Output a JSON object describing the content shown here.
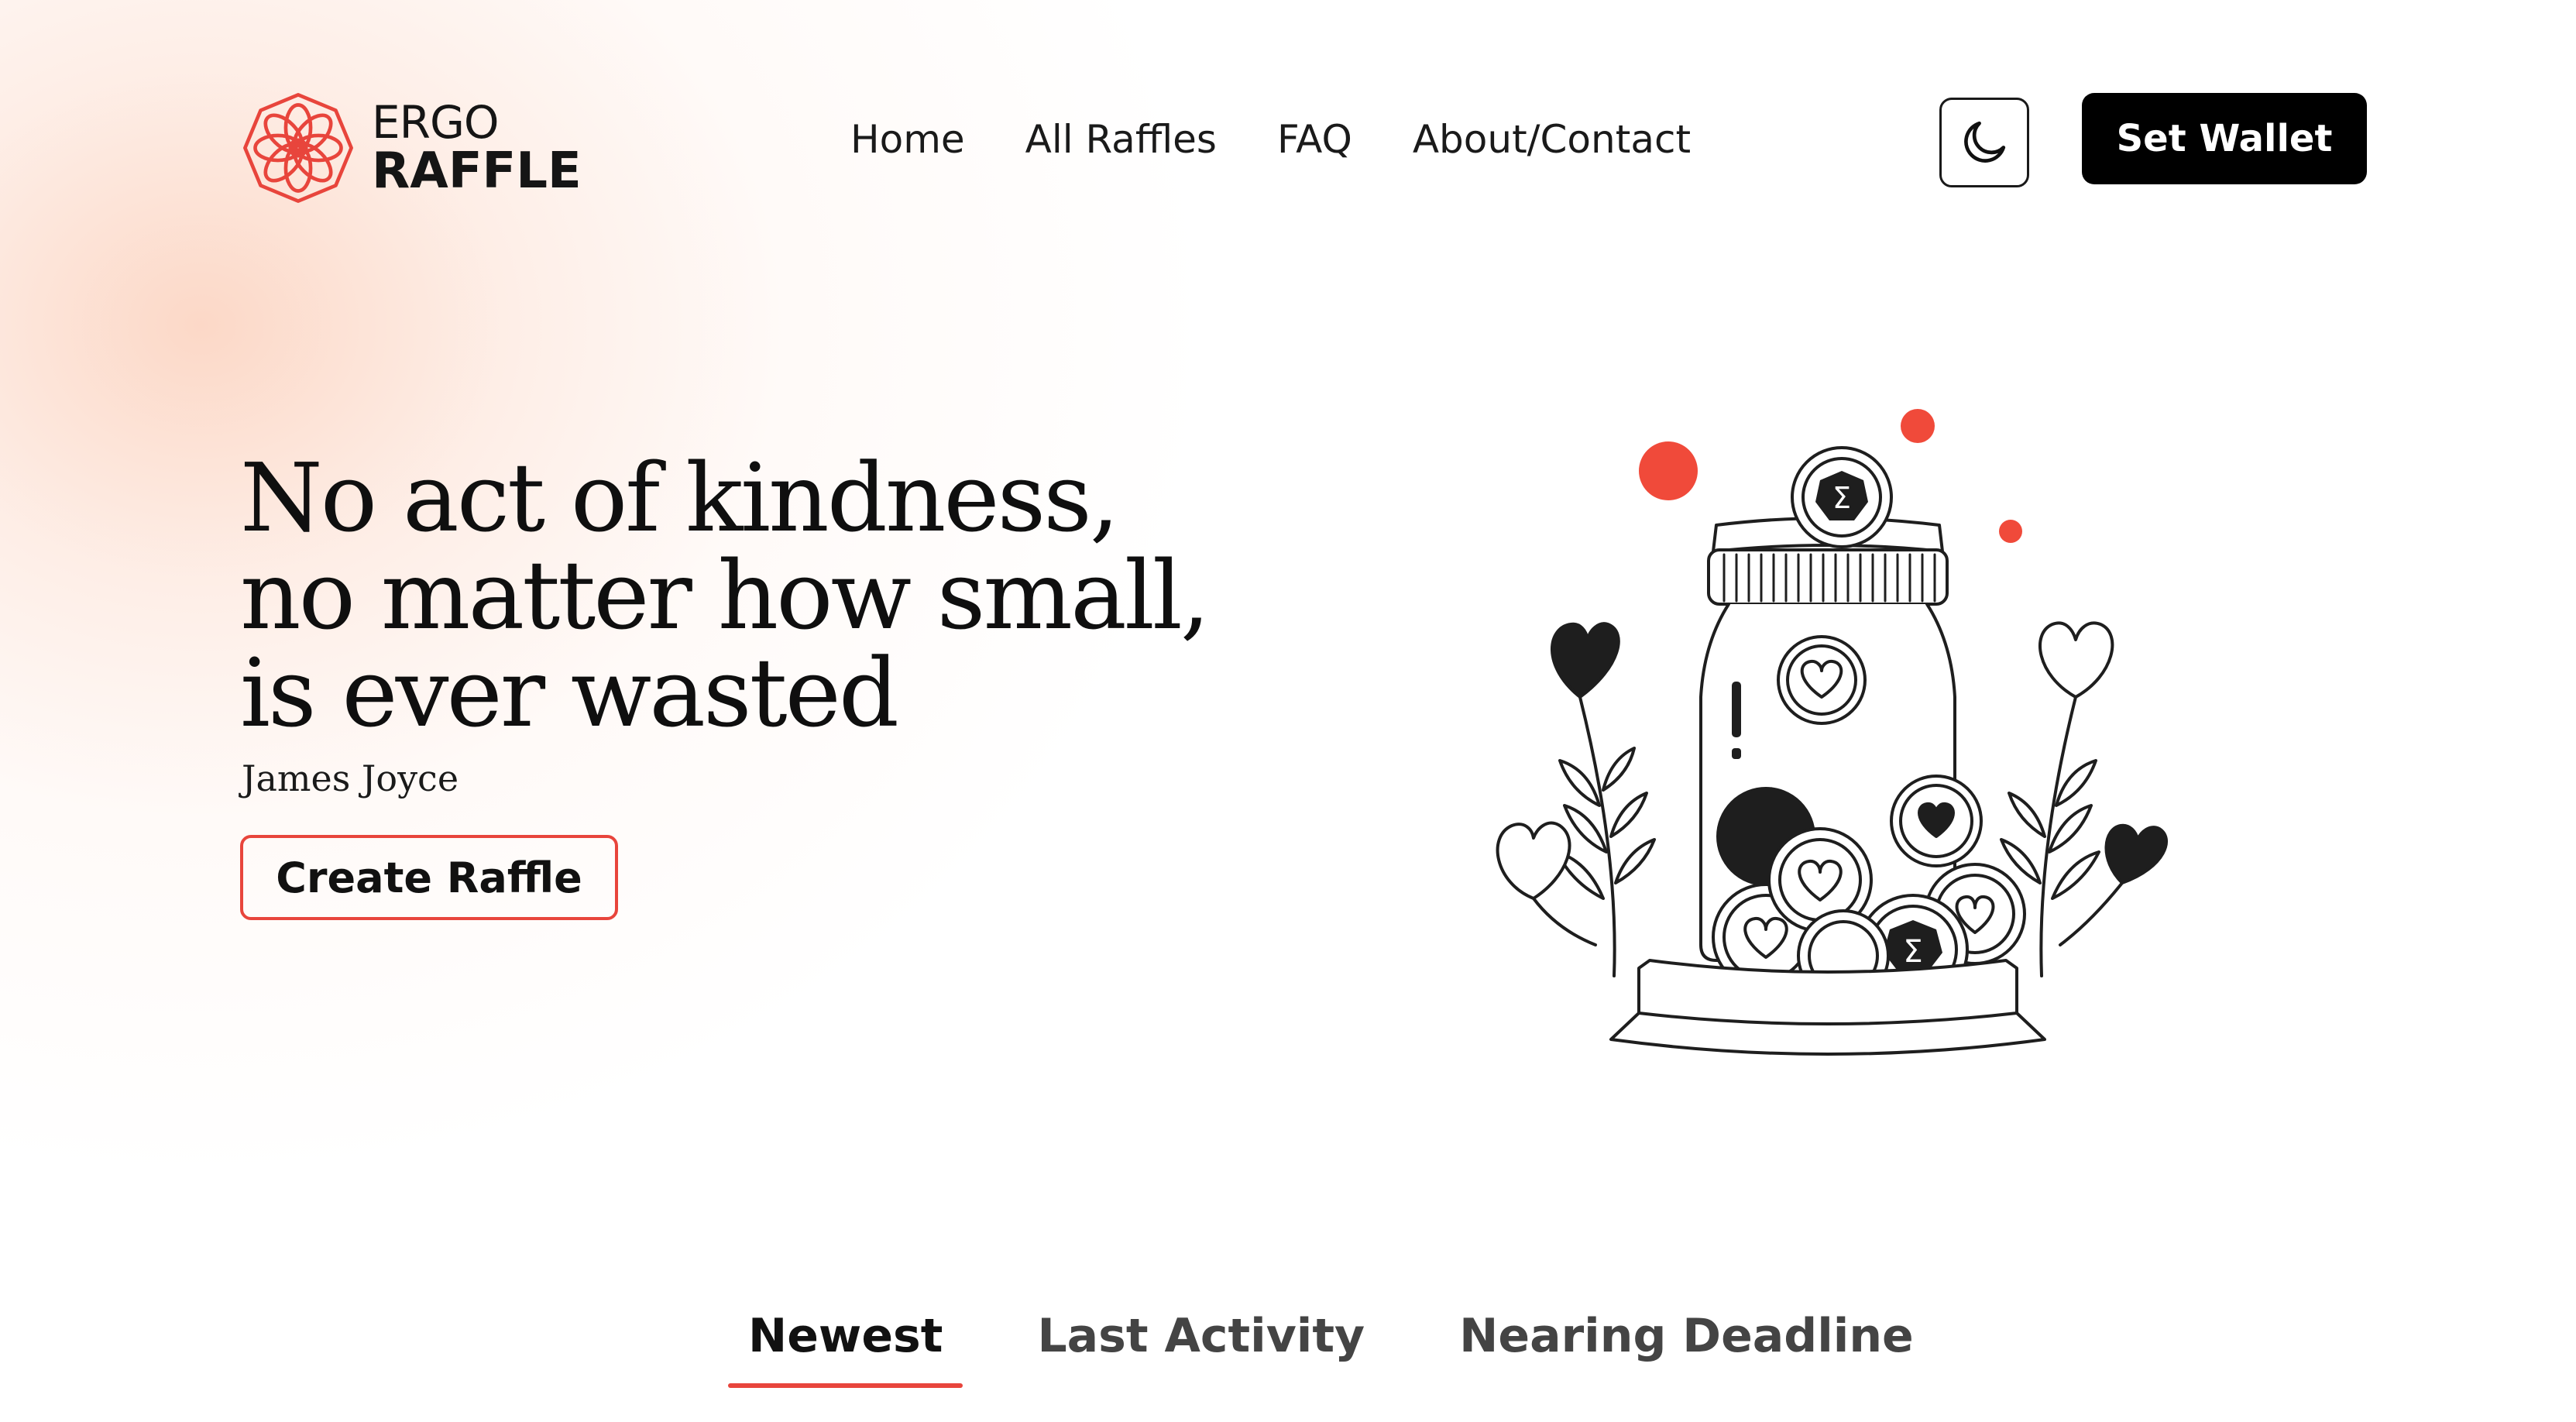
{
  "brand": {
    "name_top": "ERGO",
    "name_bottom": "RAFFLE",
    "logo_icon": "flower-mandala-icon",
    "accent_color": "#e8453c"
  },
  "nav": {
    "links": [
      {
        "label": "Home"
      },
      {
        "label": "All Raffles"
      },
      {
        "label": "FAQ"
      },
      {
        "label": "About/Contact"
      }
    ],
    "theme_toggle_icon": "moon-icon",
    "wallet_button": "Set Wallet"
  },
  "hero": {
    "quote": "No act of kindness, no matter how small, is ever wasted",
    "author": "James Joyce",
    "cta": "Create Raffle",
    "illustration": "donation-jar-with-hearts-and-ergo-coins"
  },
  "tabs": {
    "items": [
      {
        "label": "Newest",
        "active": true
      },
      {
        "label": "Last Activity",
        "active": false
      },
      {
        "label": "Nearing Deadline",
        "active": false
      }
    ]
  }
}
